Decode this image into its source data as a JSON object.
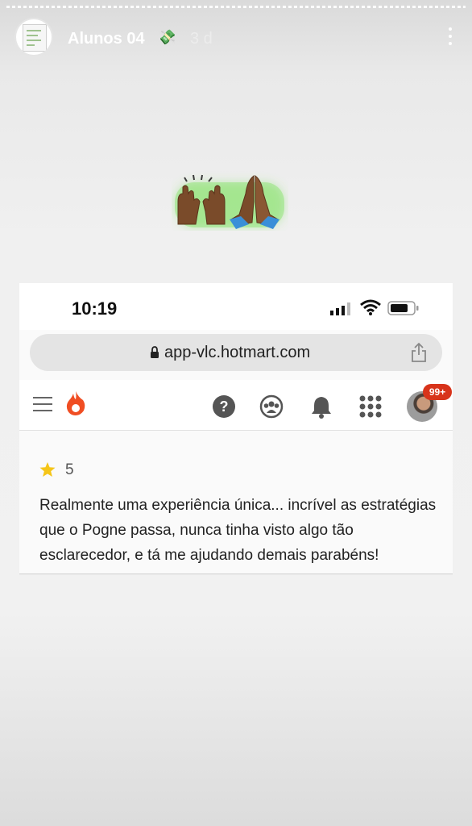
{
  "story": {
    "username": "Alunos 04",
    "emoji": "💸",
    "time": "3 d"
  },
  "screenshot": {
    "status_bar": {
      "time": "10:19"
    },
    "browser": {
      "url": "app-vlc.hotmart.com"
    },
    "app_bar": {
      "notification_count": "99+"
    },
    "review": {
      "rating": "5",
      "text": "Realmente uma experiência única... incrível as estratégias que o Pogne passa, nunca tinha visto algo tão esclarecedor, e tá me ajudando demais parabéns!"
    }
  },
  "colors": {
    "hotmart_brand": "#f04e23",
    "badge": "#d8341b",
    "star": "#f5c518",
    "emoji_glow": "#6ee04a"
  },
  "icons": [
    "more-vertical-icon",
    "raised-hands-icon",
    "praying-hands-icon",
    "signal-icon",
    "wifi-icon",
    "battery-icon",
    "lock-icon",
    "share-icon",
    "menu-icon",
    "hotmart-logo",
    "help-icon",
    "community-icon",
    "bell-icon",
    "apps-grid-icon",
    "star-icon"
  ]
}
